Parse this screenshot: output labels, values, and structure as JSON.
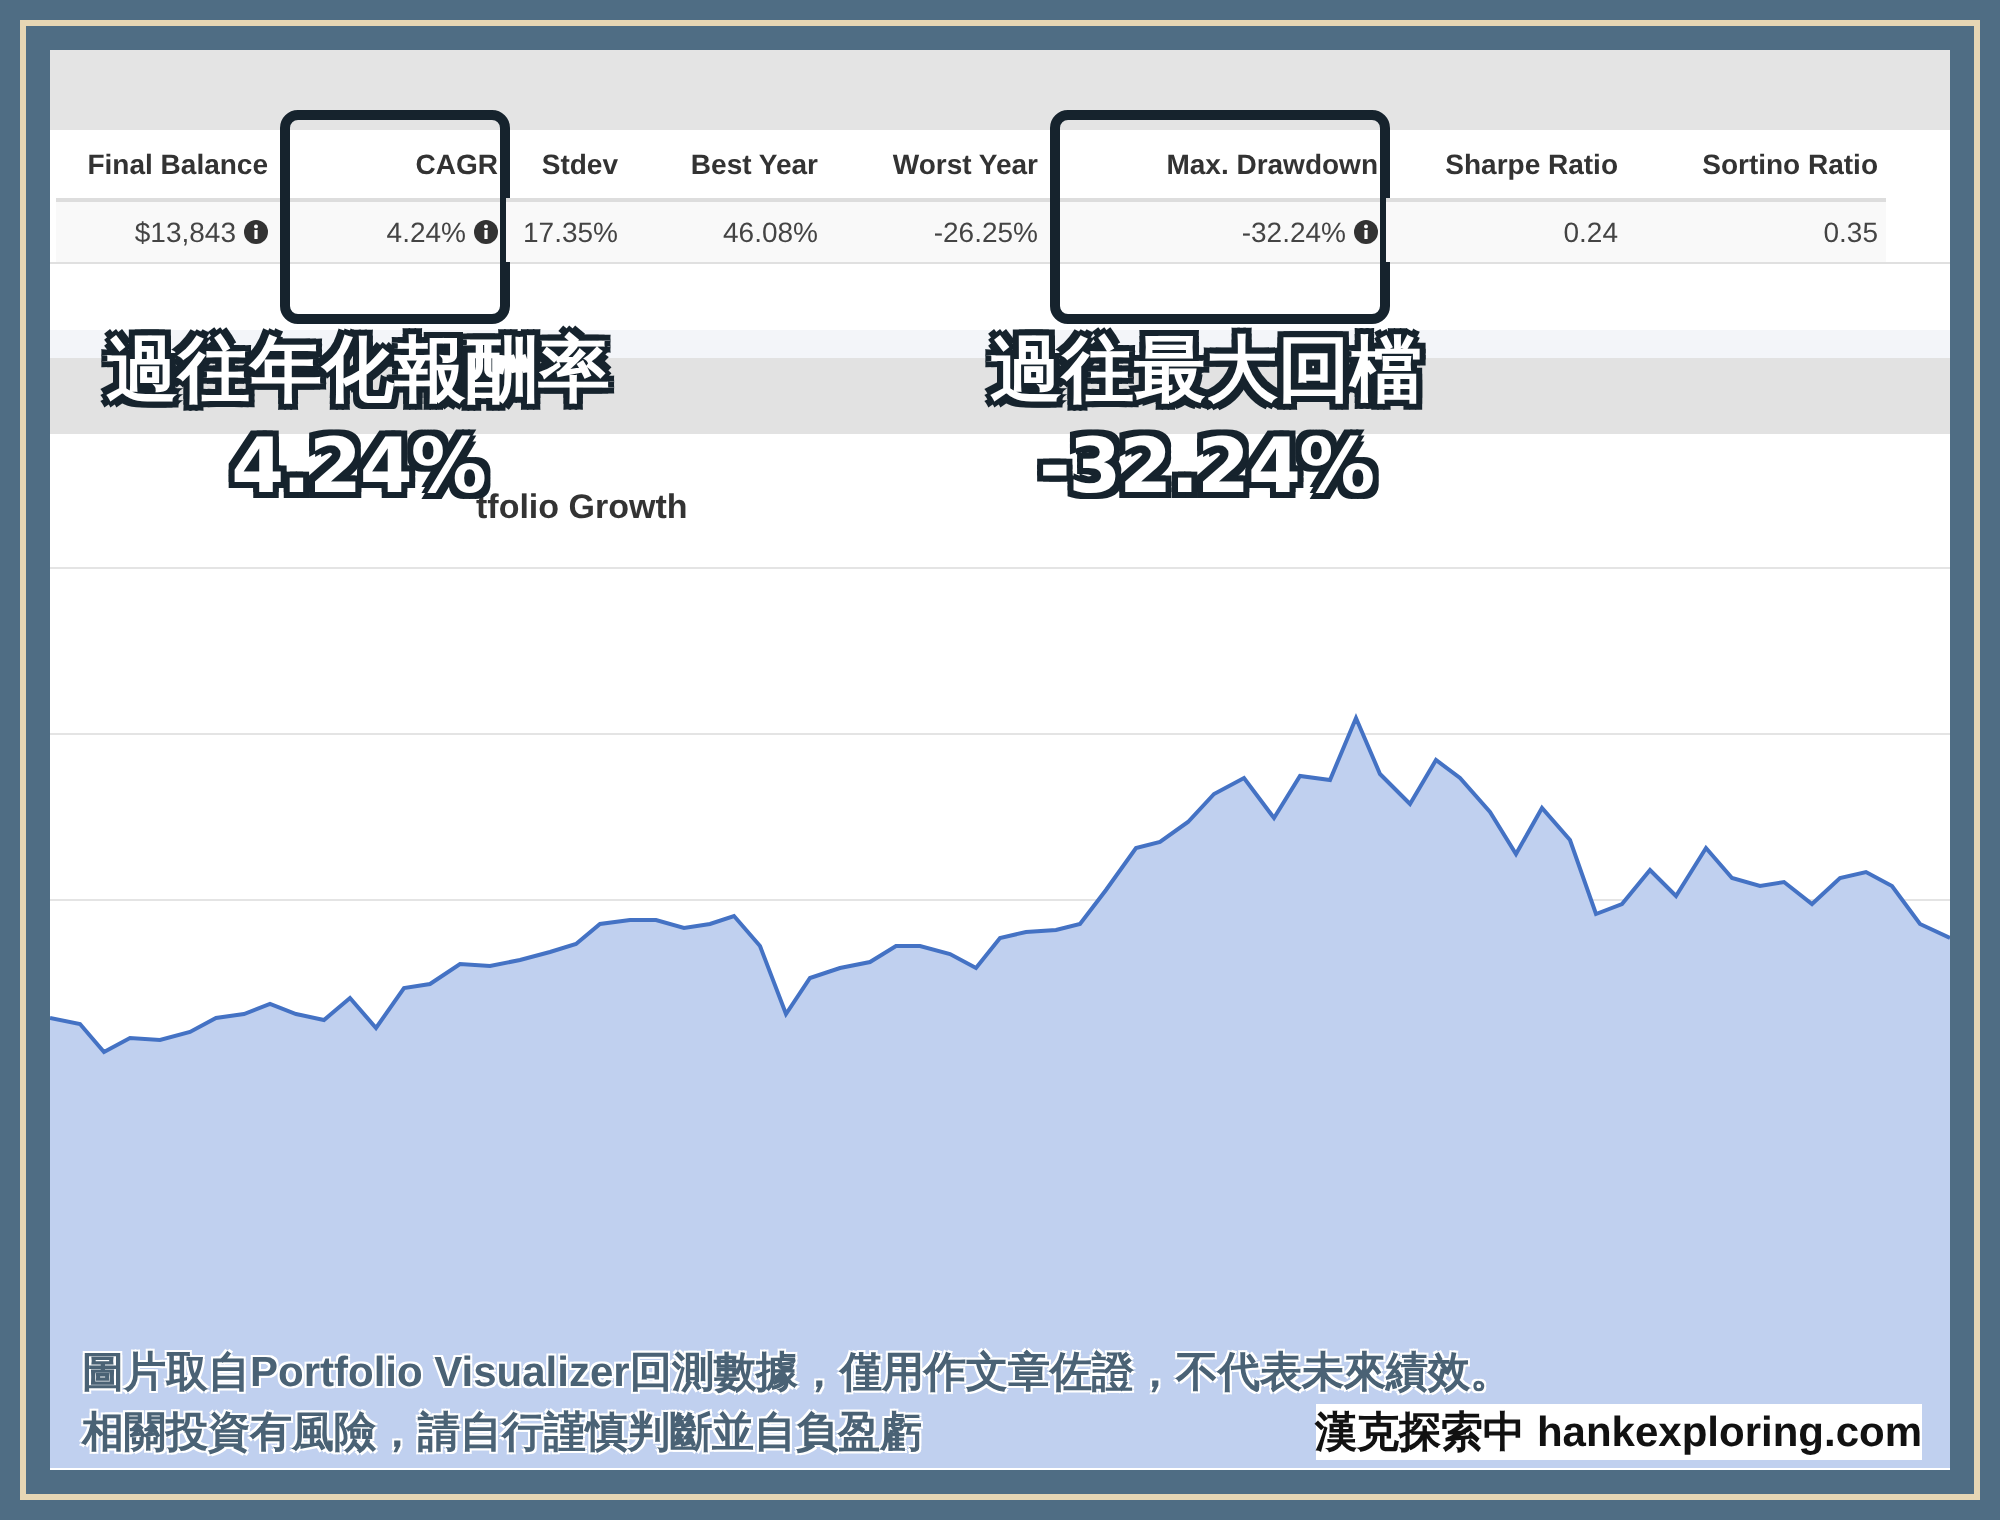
{
  "table": {
    "columns": [
      {
        "heading": "Final Balance",
        "value": "$13,843",
        "info": true,
        "highlighted": false
      },
      {
        "heading": "CAGR",
        "value": "4.24%",
        "info": true,
        "highlighted": true
      },
      {
        "heading": "Stdev",
        "value": "17.35%",
        "info": false,
        "highlighted": false
      },
      {
        "heading": "Best Year",
        "value": "46.08%",
        "info": false,
        "highlighted": false
      },
      {
        "heading": "Worst Year",
        "value": "-26.25%",
        "info": false,
        "highlighted": false
      },
      {
        "heading": "Max. Drawdown",
        "value": "-32.24%",
        "info": true,
        "highlighted": true
      },
      {
        "heading": "Sharpe Ratio",
        "value": "0.24",
        "info": false,
        "highlighted": false
      },
      {
        "heading": "Sortino Ratio",
        "value": "0.35",
        "info": false,
        "highlighted": false
      }
    ]
  },
  "annotations": [
    {
      "label": "過往年化報酬率",
      "value": "4.24%"
    },
    {
      "label": "過往最大回檔",
      "value": "-32.24%"
    }
  ],
  "chart": {
    "title": "tfolio Growth"
  },
  "caption": {
    "line_1": "圖片取自Portfolio  Visualizer回測數據，僅用作文章佐證，不代表未來績效。",
    "line_2": "相關投資有風險，請自行謹慎判斷並自負盈虧",
    "credit": "漢克探索中 hankexploring.com"
  }
}
